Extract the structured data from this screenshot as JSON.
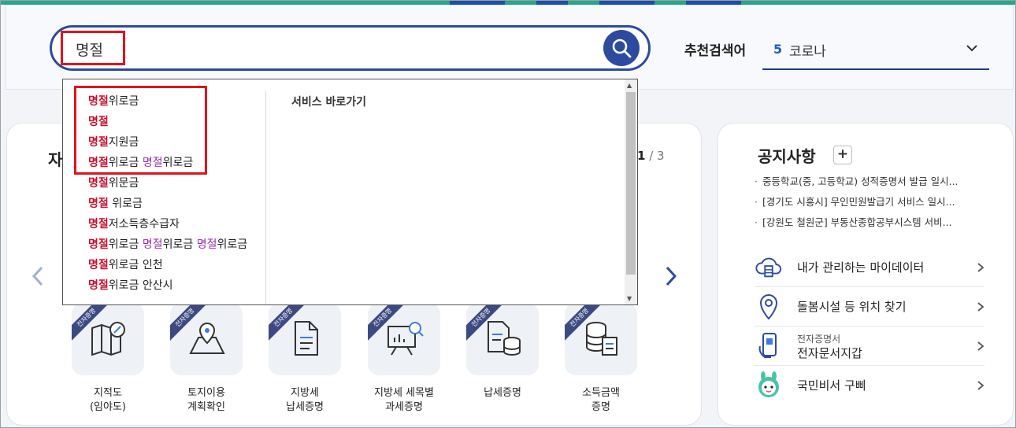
{
  "search": {
    "value": "명절",
    "button_label": "검색"
  },
  "recommend": {
    "label": "추천검색어",
    "number": "5",
    "value": "코로나"
  },
  "main_card": {
    "title_partial": "자",
    "pager_current": "1",
    "pager_sep": " / ",
    "pager_total": "3"
  },
  "services": [
    {
      "ribbon": "전자증명",
      "label1": "지적도",
      "label2": "(임야도)"
    },
    {
      "ribbon": "전자증명",
      "label1": "토지이용",
      "label2": "계획확인"
    },
    {
      "ribbon": "전자증명",
      "label1": "지방세",
      "label2": "납세증명"
    },
    {
      "ribbon": "전자증명",
      "label1": "지방세 세목별",
      "label2": "과세증명"
    },
    {
      "ribbon": "전자증명",
      "label1": "납세증명",
      "label2": ""
    },
    {
      "ribbon": "전자증명",
      "label1": "소득금액",
      "label2": "증명"
    }
  ],
  "notice": {
    "title": "공지사항",
    "plus": "+",
    "items": [
      "중등학교(중, 고등학교) 성적증명서 발급 일시...",
      "[경기도 시흥시] 무인민원발급기 서비스 일시...",
      "[강원도 철원군] 부동산종합공부시스템 서비..."
    ]
  },
  "quick_links": [
    {
      "label": "내가 관리하는 마이데이터",
      "sub": "",
      "icon": "cloud-data-icon"
    },
    {
      "label": "돌봄시설 등 위치 찾기",
      "sub": "",
      "icon": "location-pin-icon"
    },
    {
      "label": "전자문서지갑",
      "sub": "전자증명서",
      "icon": "phone-wallet-icon"
    },
    {
      "label": "국민비서 구삐",
      "sub": "",
      "icon": "gubbi-mascot-icon"
    }
  ],
  "autocomplete": {
    "service_heading": "서비스 바로가기",
    "items": [
      [
        {
          "t": "명절",
          "k": 1
        },
        {
          "t": "위로금",
          "k": 0
        }
      ],
      [
        {
          "t": "명절",
          "k": 1
        }
      ],
      [
        {
          "t": "명절",
          "k": 1
        },
        {
          "t": "지원금",
          "k": 0
        }
      ],
      [
        {
          "t": "명절",
          "k": 1
        },
        {
          "t": "위로금 ",
          "k": 0
        },
        {
          "t": "명절",
          "k": 2
        },
        {
          "t": "위로금",
          "k": 0
        }
      ],
      [
        {
          "t": "명절",
          "k": 1
        },
        {
          "t": "위문금",
          "k": 0
        }
      ],
      [
        {
          "t": "명절",
          "k": 1
        },
        {
          "t": " 위로금",
          "k": 0
        }
      ],
      [
        {
          "t": "명절",
          "k": 1
        },
        {
          "t": "저소득층수급자",
          "k": 0
        }
      ],
      [
        {
          "t": "명절",
          "k": 1
        },
        {
          "t": "위로금 ",
          "k": 0
        },
        {
          "t": "명절",
          "k": 2
        },
        {
          "t": "위로금 ",
          "k": 0
        },
        {
          "t": "명절",
          "k": 2
        },
        {
          "t": "위로금",
          "k": 0
        }
      ],
      [
        {
          "t": "명절",
          "k": 1
        },
        {
          "t": "위로금 인천",
          "k": 0
        }
      ],
      [
        {
          "t": "명절",
          "k": 1
        },
        {
          "t": "위로금 안산시",
          "k": 0
        }
      ]
    ]
  },
  "colors": {
    "accent": "#2c4ba0",
    "keyword": "#c8102e",
    "keyword_secondary": "#9b2fae",
    "highlight": "#e0141e"
  }
}
